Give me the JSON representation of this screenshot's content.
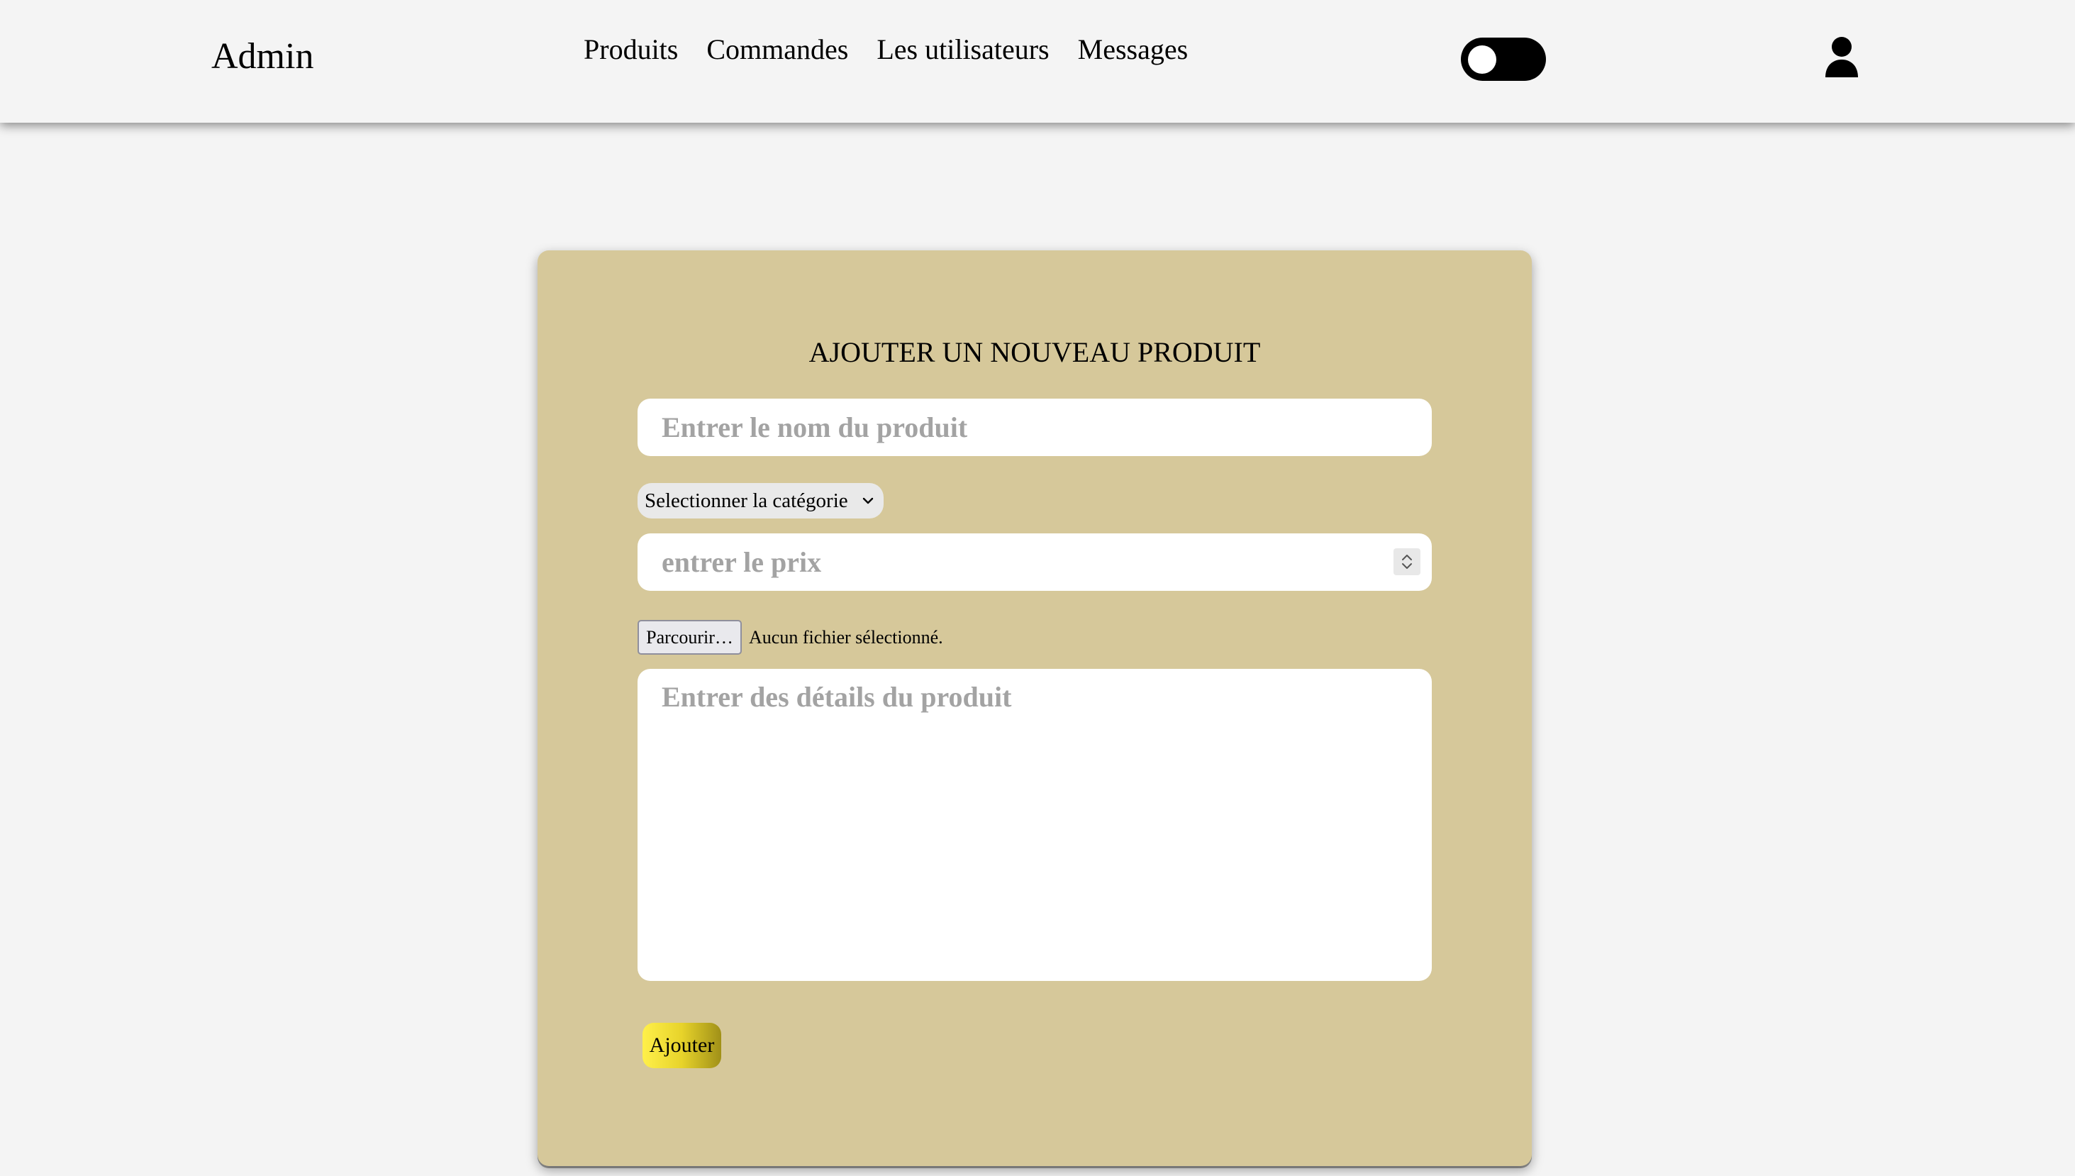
{
  "header": {
    "brand": "Admin",
    "nav": [
      {
        "label": "Produits"
      },
      {
        "label": "Commandes"
      },
      {
        "label": "Les utilisateurs"
      },
      {
        "label": "Messages"
      }
    ],
    "icons": {
      "theme_toggle": "toggle-switch",
      "account": "user-icon"
    }
  },
  "form": {
    "title": "AJOUTER UN NOUVEAU PRODUIT",
    "name_placeholder": "Entrer le nom du produit",
    "name_value": "",
    "category_selected": "Selectionner la catégorie",
    "price_placeholder": "entrer le prix",
    "price_value": "",
    "file_button_label": "Parcourir…",
    "file_status": "Aucun fichier sélectionné.",
    "details_placeholder": "Entrer des détails du produit",
    "details_value": "",
    "submit_label": "Ajouter"
  },
  "colors": {
    "page_background": "#f4f4f4",
    "card_background": "#d6c89a",
    "submit_gradient_start": "#fff04a",
    "submit_gradient_end": "#a09018",
    "placeholder_text": "#a3a3a3"
  }
}
